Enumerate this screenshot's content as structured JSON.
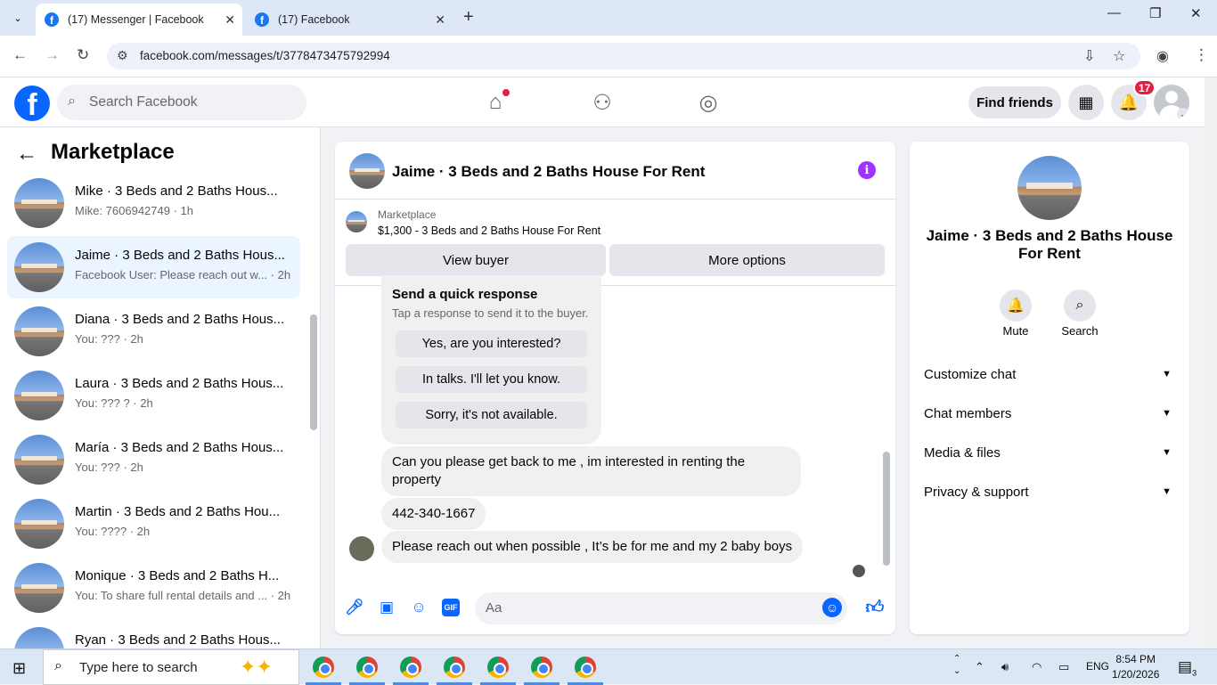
{
  "browser": {
    "tabs": [
      {
        "title": "(17) Messenger | Facebook",
        "active": true
      },
      {
        "title": "(17) Facebook",
        "active": false
      }
    ],
    "url": "facebook.com/messages/t/3778473475792994"
  },
  "fb_header": {
    "logo": "f",
    "search_placeholder": "Search Facebook",
    "find_friends": "Find friends",
    "notification_count": "17"
  },
  "sidebar": {
    "title": "Marketplace",
    "conversations": [
      {
        "name": "Mike · 3 Beds and 2 Baths Hous...",
        "preview": "Mike: 7606942749 · 1h",
        "selected": false
      },
      {
        "name": "Jaime · 3 Beds and 2 Baths Hous...",
        "preview": "Facebook User: Please reach out w... · 2h",
        "selected": true
      },
      {
        "name": "Diana · 3 Beds and 2 Baths Hous...",
        "preview": "You: ??? · 2h",
        "selected": false
      },
      {
        "name": "Laura · 3 Beds and 2 Baths Hous...",
        "preview": "You: ??? ? · 2h",
        "selected": false
      },
      {
        "name": "María · 3 Beds and 2 Baths Hous...",
        "preview": "You: ??? · 2h",
        "selected": false
      },
      {
        "name": "Martin · 3 Beds and 2 Baths Hou...",
        "preview": "You: ???? · 2h",
        "selected": false
      },
      {
        "name": "Monique · 3 Beds and 2 Baths H...",
        "preview": "You: To share full rental details and ... · 2h",
        "selected": false
      },
      {
        "name": "Ryan · 3 Beds and 2 Baths Hous...",
        "preview": "",
        "selected": false
      }
    ]
  },
  "chat": {
    "title": "Jaime · 3 Beds and 2 Baths House For Rent",
    "marketplace_label": "Marketplace",
    "listing": "$1,300 - 3 Beds and 2 Baths House For Rent",
    "view_buyer": "View buyer",
    "more_options": "More options",
    "quick_response": {
      "title": "Send a quick response",
      "subtitle": "Tap a response to send it to the buyer.",
      "options": [
        "Yes, are you interested?",
        "In talks. I'll let you know.",
        "Sorry, it's not available."
      ]
    },
    "messages": [
      "Can you please get back to me , im interested in renting the property",
      "442-340-1667",
      "Please reach out when possible , It’s be for me and my 2 baby boys"
    ],
    "composer_placeholder": "Aa"
  },
  "info_panel": {
    "title": "Jaime · 3 Beds and 2 Baths House For Rent",
    "mute": "Mute",
    "search": "Search",
    "sections": [
      "Customize chat",
      "Chat members",
      "Media & files",
      "Privacy & support"
    ]
  },
  "taskbar": {
    "search_placeholder": "Type here to search",
    "lang": "ENG",
    "time": "8:54 PM",
    "date": "1/20/2026",
    "notif_count": "3"
  }
}
